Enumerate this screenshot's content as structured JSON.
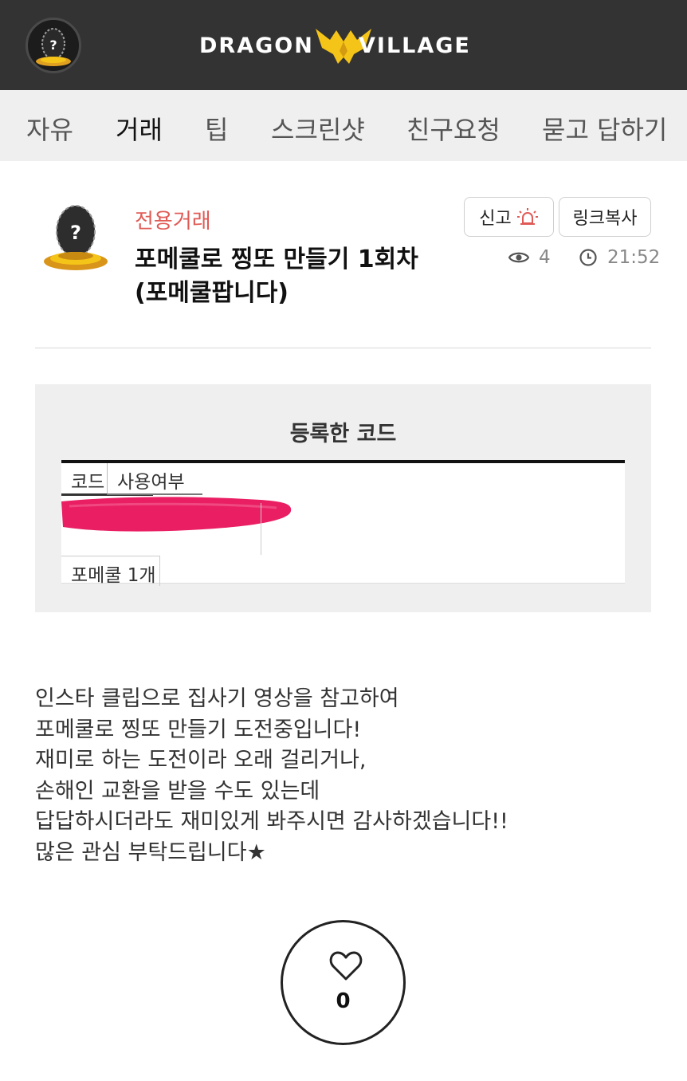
{
  "header": {
    "logo_left": "DRAGON",
    "logo_right": "VILLAGE"
  },
  "tabs": [
    {
      "label": "자유"
    },
    {
      "label": "거래"
    },
    {
      "label": "팁"
    },
    {
      "label": "스크린샷"
    },
    {
      "label": "친구요청"
    },
    {
      "label": "묻고 답하기"
    }
  ],
  "active_tab": "거래",
  "post": {
    "category": "전용거래",
    "title_line1": "포메쿨로 찡또 만들기 1회차",
    "title_line2": "(포메쿨팝니다)",
    "report_label": "신고",
    "copy_link_label": "링크복사",
    "views": "4",
    "time": "21:52"
  },
  "code_box": {
    "title": "등록한 코드",
    "col_code": "코드",
    "col_used": "사용여부",
    "row_item": "포메쿨 1개"
  },
  "body_lines": [
    "인스타 클립으로 집사기 영상을 참고하여",
    "포메쿨로 찡또 만들기 도전중입니다!",
    "재미로 하는 도전이라 오래 걸리거나,",
    "손해인 교환을 받을 수도 있는데",
    "답답하시더라도 재미있게 봐주시면 감사하겠습니다!!",
    "많은 관심 부탁드립니다★"
  ],
  "like": {
    "count": "0"
  },
  "colors": {
    "header_bg": "#333333",
    "tab_bg": "#efefef",
    "active_underline": "#f5c418",
    "category": "#e05a55",
    "redaction": "#e91e63",
    "logo_emblem": "#f5c418"
  },
  "icons": {
    "report": "siren-icon",
    "views": "eye-icon",
    "time": "clock-icon",
    "like": "heart-icon"
  }
}
